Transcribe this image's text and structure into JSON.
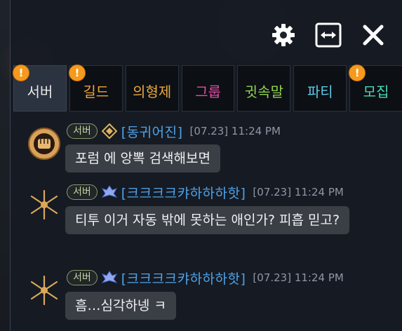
{
  "window": {
    "settings_icon": "gear-icon",
    "resize_icon": "horizontal-expand-icon",
    "close_icon": "close-icon"
  },
  "tabs": [
    {
      "label": "서버",
      "color": "#e8e8e8",
      "active": true,
      "badge": "!"
    },
    {
      "label": "길드",
      "color": "#f2a33a",
      "active": false,
      "badge": "!"
    },
    {
      "label": "의형제",
      "color": "#e8a83a",
      "active": false,
      "badge": ""
    },
    {
      "label": "그룹",
      "color": "#e84aa6",
      "active": false,
      "badge": ""
    },
    {
      "label": "귓속말",
      "color": "#8fd14f",
      "active": false,
      "badge": ""
    },
    {
      "label": "파티",
      "color": "#5ec8e8",
      "active": false,
      "badge": ""
    },
    {
      "label": "모집",
      "color": "#48d9b6",
      "active": false,
      "badge": "!"
    }
  ],
  "messages": [
    {
      "server": "서버",
      "name": "[동귀어진]",
      "time": "[07.23] 11:24 PM",
      "text": "포럼 에 앙뽁 검색해보면",
      "avatar": "fist-emblem-icon",
      "class_icon": "gold-diamond-icon"
    },
    {
      "server": "서버",
      "name": "[크크크크캬하하하핫]",
      "time": "[07.23] 11:24 PM",
      "text": "티투 이거 자동 밖에 못하는 애인가? 피흡 믿고?",
      "avatar": "gold-blades-icon",
      "class_icon": "blue-wing-icon"
    },
    {
      "server": "서버",
      "name": "[크크크크캬하하하핫]",
      "time": "[07.23] 11:24 PM",
      "text": "흠…심각하넹 ㅋ",
      "avatar": "gold-blades-icon",
      "class_icon": "blue-wing-icon"
    }
  ]
}
